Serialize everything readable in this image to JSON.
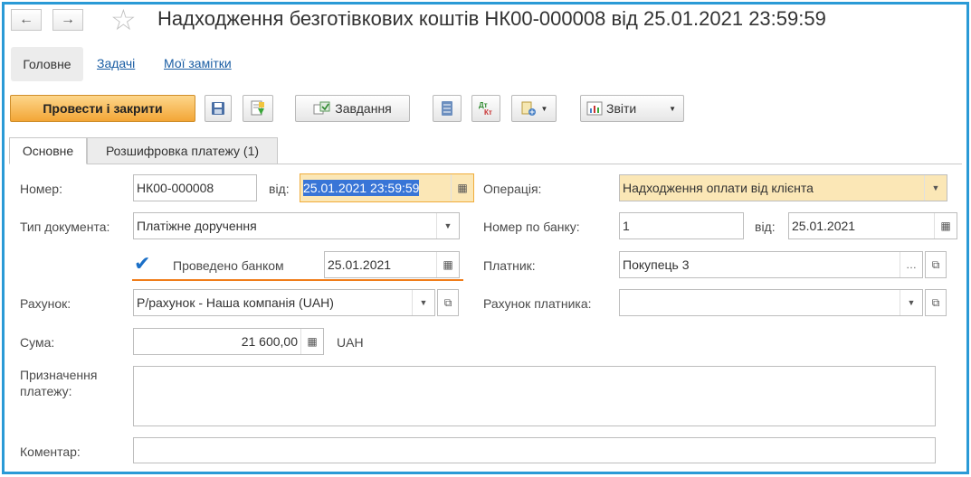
{
  "window": {
    "title": "Надходження безготівкових коштів НК00-000008 від 25.01.2021 23:59:59"
  },
  "nav": {
    "back_glyph": "←",
    "forward_glyph": "→",
    "star_glyph": "☆"
  },
  "menu": {
    "main": "Головне",
    "tasks": "Задачі",
    "notes": "Мої замітки"
  },
  "toolbar": {
    "post_close": "Провести і закрити",
    "task": "Завдання",
    "reports": "Звіти"
  },
  "tabs": {
    "main": "Основне",
    "decoding": "Розшифровка платежу (1)"
  },
  "form": {
    "number_label": "Номер:",
    "number_value": "НК00-000008",
    "from_label": "від:",
    "date_value": "25.01.2021 23:59:59",
    "operation_label": "Операція:",
    "operation_value": "Надходження оплати від клієнта",
    "doc_type_label": "Тип документа:",
    "doc_type_value": "Платіжне доручення",
    "bank_number_label": "Номер по банку:",
    "bank_number_value": "1",
    "bank_from_label": "від:",
    "bank_date_value": "25.01.2021",
    "bank_posted_label": "Проведено банком",
    "bank_posted_date": "25.01.2021",
    "bank_posted_checked": true,
    "payer_label": "Платник:",
    "payer_value": "Покупець 3",
    "account_label": "Рахунок:",
    "account_value": "Р/рахунок - Наша компанія (UAH)",
    "payer_account_label": "Рахунок платника:",
    "payer_account_value": "",
    "sum_label": "Сума:",
    "sum_value": "21 600,00",
    "currency": "UAH",
    "purpose_label_1": "Призначення",
    "purpose_label_2": "платежу:",
    "purpose_value": "",
    "comment_label": "Коментар:",
    "comment_value": ""
  },
  "colors": {
    "frame": "#2a9ad6",
    "primary_button": "#f3a636",
    "highlight_field": "#fbe7b6",
    "underline": "#f07d1a",
    "link": "#1b5ea4"
  }
}
